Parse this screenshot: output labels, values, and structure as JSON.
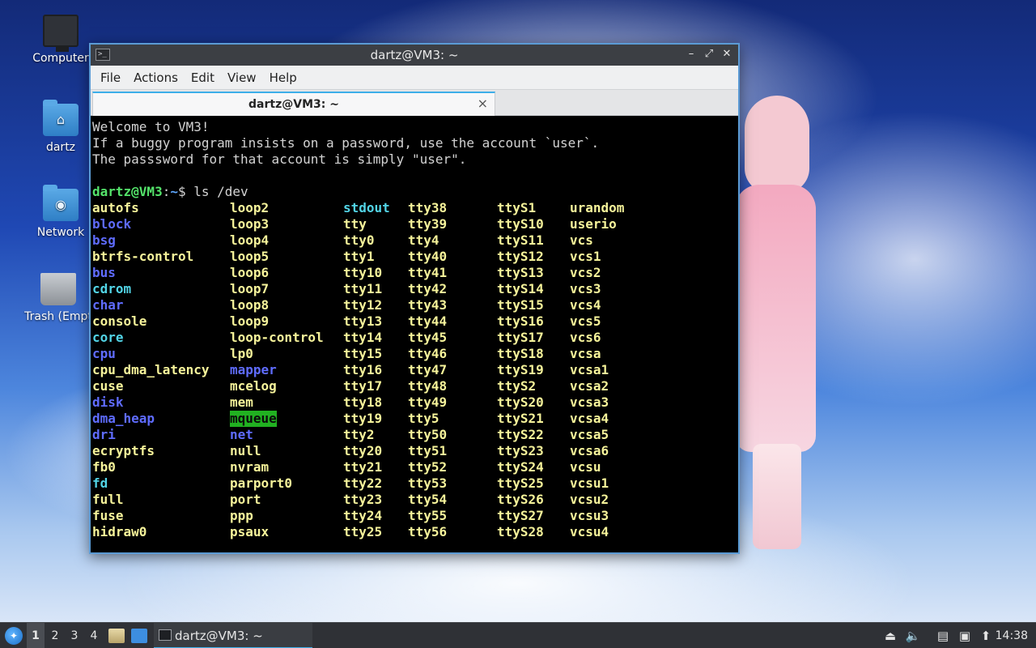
{
  "desktop": {
    "icons": [
      {
        "label": "Computer",
        "icon": "monitor-icon"
      },
      {
        "label": "dartz",
        "icon": "home-folder-icon"
      },
      {
        "label": "Network",
        "icon": "network-folder-icon"
      },
      {
        "label": "Trash (Empt",
        "icon": "trash-icon"
      }
    ]
  },
  "window": {
    "title": "dartz@VM3: ~",
    "controls": {
      "minimize": "–",
      "maximize": "⤢",
      "close": "✕"
    },
    "menu": [
      "File",
      "Actions",
      "Edit",
      "View",
      "Help"
    ],
    "tab": {
      "title": "dartz@VM3: ~",
      "close": "×"
    }
  },
  "terminal": {
    "motd": [
      "Welcome to VM3!",
      "If a buggy program insists on a password, use the account `user`.",
      "The passsword for that account is simply \"user\"."
    ],
    "prompt_user": "dartz@VM3",
    "prompt_sep": ":",
    "prompt_path": "~",
    "prompt_symbol": "$ ",
    "command": "ls /dev",
    "colors": {
      "file": "#f6f39a",
      "dir": "#5f6cff",
      "link": "#52d4e6",
      "sticky_bg": "#21b121"
    },
    "columns": [
      [
        [
          "autofs",
          "f"
        ],
        [
          "block",
          "d"
        ],
        [
          "bsg",
          "d"
        ],
        [
          "btrfs-control",
          "f"
        ],
        [
          "bus",
          "d"
        ],
        [
          "cdrom",
          "l"
        ],
        [
          "char",
          "d"
        ],
        [
          "console",
          "f"
        ],
        [
          "core",
          "l"
        ],
        [
          "cpu",
          "d"
        ],
        [
          "cpu_dma_latency",
          "f"
        ],
        [
          "cuse",
          "f"
        ],
        [
          "disk",
          "d"
        ],
        [
          "dma_heap",
          "d"
        ],
        [
          "dri",
          "d"
        ],
        [
          "ecryptfs",
          "f"
        ],
        [
          "fb0",
          "f"
        ],
        [
          "fd",
          "l"
        ],
        [
          "full",
          "f"
        ],
        [
          "fuse",
          "f"
        ],
        [
          "hidraw0",
          "f"
        ]
      ],
      [
        [
          "loop2",
          "f"
        ],
        [
          "loop3",
          "f"
        ],
        [
          "loop4",
          "f"
        ],
        [
          "loop5",
          "f"
        ],
        [
          "loop6",
          "f"
        ],
        [
          "loop7",
          "f"
        ],
        [
          "loop8",
          "f"
        ],
        [
          "loop9",
          "f"
        ],
        [
          "loop-control",
          "f"
        ],
        [
          "lp0",
          "f"
        ],
        [
          "mapper",
          "d"
        ],
        [
          "mcelog",
          "f"
        ],
        [
          "mem",
          "f"
        ],
        [
          "mqueue",
          "s"
        ],
        [
          "net",
          "d"
        ],
        [
          "null",
          "f"
        ],
        [
          "nvram",
          "f"
        ],
        [
          "parport0",
          "f"
        ],
        [
          "port",
          "f"
        ],
        [
          "ppp",
          "f"
        ],
        [
          "psaux",
          "f"
        ]
      ],
      [
        [
          "stdout",
          "l"
        ],
        [
          "tty",
          "f"
        ],
        [
          "tty0",
          "f"
        ],
        [
          "tty1",
          "f"
        ],
        [
          "tty10",
          "f"
        ],
        [
          "tty11",
          "f"
        ],
        [
          "tty12",
          "f"
        ],
        [
          "tty13",
          "f"
        ],
        [
          "tty14",
          "f"
        ],
        [
          "tty15",
          "f"
        ],
        [
          "tty16",
          "f"
        ],
        [
          "tty17",
          "f"
        ],
        [
          "tty18",
          "f"
        ],
        [
          "tty19",
          "f"
        ],
        [
          "tty2",
          "f"
        ],
        [
          "tty20",
          "f"
        ],
        [
          "tty21",
          "f"
        ],
        [
          "tty22",
          "f"
        ],
        [
          "tty23",
          "f"
        ],
        [
          "tty24",
          "f"
        ],
        [
          "tty25",
          "f"
        ]
      ],
      [
        [
          "tty38",
          "f"
        ],
        [
          "tty39",
          "f"
        ],
        [
          "tty4",
          "f"
        ],
        [
          "tty40",
          "f"
        ],
        [
          "tty41",
          "f"
        ],
        [
          "tty42",
          "f"
        ],
        [
          "tty43",
          "f"
        ],
        [
          "tty44",
          "f"
        ],
        [
          "tty45",
          "f"
        ],
        [
          "tty46",
          "f"
        ],
        [
          "tty47",
          "f"
        ],
        [
          "tty48",
          "f"
        ],
        [
          "tty49",
          "f"
        ],
        [
          "tty5",
          "f"
        ],
        [
          "tty50",
          "f"
        ],
        [
          "tty51",
          "f"
        ],
        [
          "tty52",
          "f"
        ],
        [
          "tty53",
          "f"
        ],
        [
          "tty54",
          "f"
        ],
        [
          "tty55",
          "f"
        ],
        [
          "tty56",
          "f"
        ]
      ],
      [
        [
          "ttyS1",
          "f"
        ],
        [
          "ttyS10",
          "f"
        ],
        [
          "ttyS11",
          "f"
        ],
        [
          "ttyS12",
          "f"
        ],
        [
          "ttyS13",
          "f"
        ],
        [
          "ttyS14",
          "f"
        ],
        [
          "ttyS15",
          "f"
        ],
        [
          "ttyS16",
          "f"
        ],
        [
          "ttyS17",
          "f"
        ],
        [
          "ttyS18",
          "f"
        ],
        [
          "ttyS19",
          "f"
        ],
        [
          "ttyS2",
          "f"
        ],
        [
          "ttyS20",
          "f"
        ],
        [
          "ttyS21",
          "f"
        ],
        [
          "ttyS22",
          "f"
        ],
        [
          "ttyS23",
          "f"
        ],
        [
          "ttyS24",
          "f"
        ],
        [
          "ttyS25",
          "f"
        ],
        [
          "ttyS26",
          "f"
        ],
        [
          "ttyS27",
          "f"
        ],
        [
          "ttyS28",
          "f"
        ]
      ],
      [
        [
          "urandom",
          "f"
        ],
        [
          "userio",
          "f"
        ],
        [
          "vcs",
          "f"
        ],
        [
          "vcs1",
          "f"
        ],
        [
          "vcs2",
          "f"
        ],
        [
          "vcs3",
          "f"
        ],
        [
          "vcs4",
          "f"
        ],
        [
          "vcs5",
          "f"
        ],
        [
          "vcs6",
          "f"
        ],
        [
          "vcsa",
          "f"
        ],
        [
          "vcsa1",
          "f"
        ],
        [
          "vcsa2",
          "f"
        ],
        [
          "vcsa3",
          "f"
        ],
        [
          "vcsa4",
          "f"
        ],
        [
          "vcsa5",
          "f"
        ],
        [
          "vcsa6",
          "f"
        ],
        [
          "vcsu",
          "f"
        ],
        [
          "vcsu1",
          "f"
        ],
        [
          "vcsu2",
          "f"
        ],
        [
          "vcsu3",
          "f"
        ],
        [
          "vcsu4",
          "f"
        ]
      ]
    ]
  },
  "taskbar": {
    "desktops": [
      "1",
      "2",
      "3",
      "4"
    ],
    "active_desktop": "1",
    "task_title": "dartz@VM3: ~",
    "tray_icons": [
      "storage-icon",
      "volume-icon",
      "clipboard-icon",
      "network-icon",
      "update-icon"
    ],
    "clock": "14:38"
  }
}
